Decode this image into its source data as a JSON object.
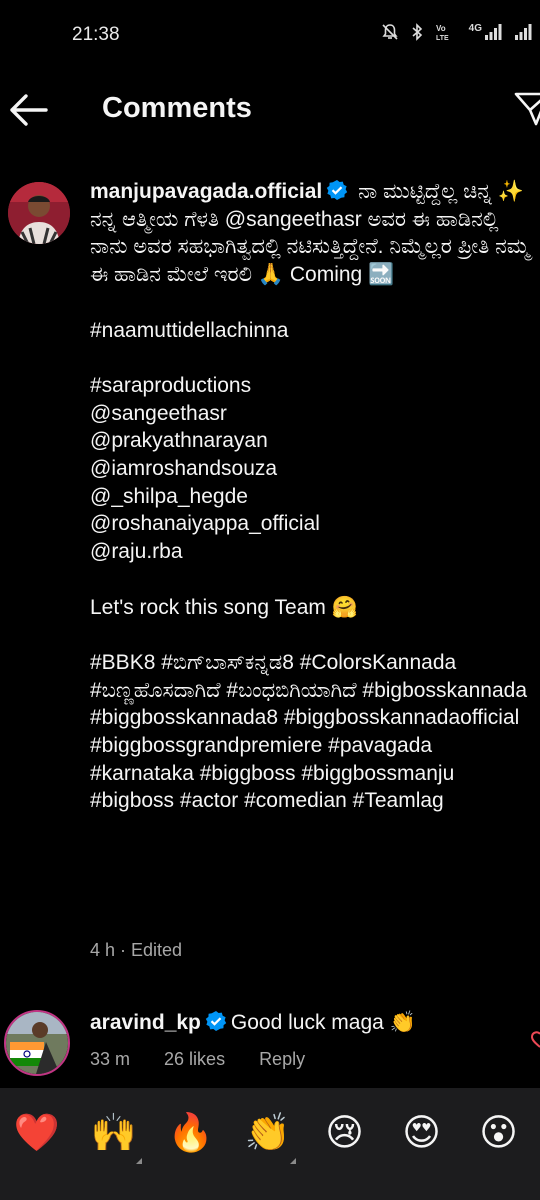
{
  "status_bar": {
    "time": "21:38",
    "network": "4G"
  },
  "header": {
    "title": "Comments"
  },
  "comment": {
    "username": "manjupavagada.official",
    "body": " ನಾ ಮುಟ್ಟಿದ್ದೆಲ್ಲ ಚಿನ್ನ ✨ ನನ್ನ ಆತ್ಮೀಯ ಗೆಳತಿ @sangeethasr ಅವರ ಈ ಹಾಡಿನಲ್ಲಿ ನಾನು ಅವರ ಸಹಭಾಗಿತ್ವದಲ್ಲಿ ನಟಿಸುತ್ತಿದ್ದೇನೆ. ನಿಮ್ಮೆಲ್ಲರ ಪ್ರೀತಿ ನಮ್ಮ ಈ ಹಾಡಿನ ಮೇಲೆ ಇರಲಿ 🙏 Coming 🔜\n\n#naamuttidellachinna\n\n#saraproductions\n@sangeethasr\n@prakyathnarayan\n@iamroshandsouza\n@_shilpa_hegde\n@roshanaiyappa_official\n@raju.rba\n\nLet's rock this song Team 🤗\n\n#BBK8 #ಬಿಗ್‌ಬಾಸ್‌ಕನ್ನಡ8 #ColorsKannada #ಬಣ್ಣಹೊಸದಾಗಿದೆ #ಬಂಧಬಿಗಿಯಾಗಿದೆ #bigbosskannada #biggbosskannada8 #biggbosskannadaofficial #biggbossgrandpremiere #pavagada #karnataka #biggboss #biggbossmanju #bigboss #actor #comedian #Teamlag",
    "meta": "4 h · Edited"
  },
  "reply": {
    "username": "aravind_kp",
    "text": "Good luck maga 👏",
    "time": "33 m",
    "likes": "26 likes",
    "reply_label": "Reply"
  },
  "emoji_bar": [
    "❤️",
    "🙌",
    "🔥",
    "👏",
    "😢",
    "😍",
    "😮",
    "😂"
  ],
  "colors": {
    "background": "#000000",
    "secondary_text": "#a8a8a8",
    "verified": "#0095f6",
    "emoji_bar": "#1c1c1e"
  }
}
